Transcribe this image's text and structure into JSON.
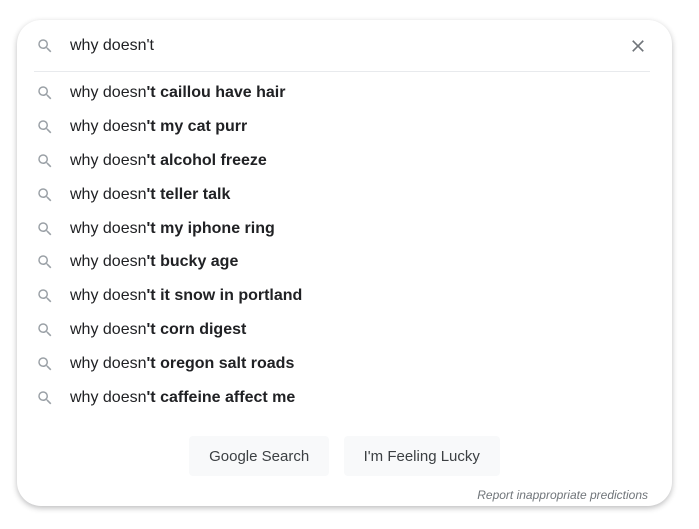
{
  "search": {
    "value": "why doesn't",
    "icon": "search-icon",
    "clear_icon": "close-icon"
  },
  "suggestions": [
    {
      "prefix": "why doesn",
      "mid": "'t",
      "rest": " ",
      "bold": "caillou have hair"
    },
    {
      "prefix": "why doesn",
      "mid": "'t",
      "rest": " ",
      "bold": "my cat purr"
    },
    {
      "prefix": "why doesn",
      "mid": "'t",
      "rest": " ",
      "bold": "alcohol freeze"
    },
    {
      "prefix": "why doesn",
      "mid": "'t",
      "rest": " ",
      "bold": "teller talk"
    },
    {
      "prefix": "why doesn",
      "mid": "'t",
      "rest": " ",
      "bold": "my iphone ring"
    },
    {
      "prefix": "why doesn",
      "mid": "'t",
      "rest": " ",
      "bold": "bucky age"
    },
    {
      "prefix": "why doesn",
      "mid": "'t",
      "rest": " ",
      "bold": "it snow in portland"
    },
    {
      "prefix": "why doesn",
      "mid": "'t",
      "rest": " ",
      "bold": "corn digest"
    },
    {
      "prefix": "why doesn",
      "mid": "'t",
      "rest": " ",
      "bold": "oregon salt roads"
    },
    {
      "prefix": "why doesn",
      "mid": "'t",
      "rest": " ",
      "bold": "caffeine affect me"
    }
  ],
  "buttons": {
    "search_label": "Google Search",
    "lucky_label": "I'm Feeling Lucky"
  },
  "report_link": "Report inappropriate predictions",
  "colors": {
    "text": "#202124",
    "icon": "#9aa0a6",
    "button_bg": "#f8f9fa",
    "muted": "#70757a"
  }
}
